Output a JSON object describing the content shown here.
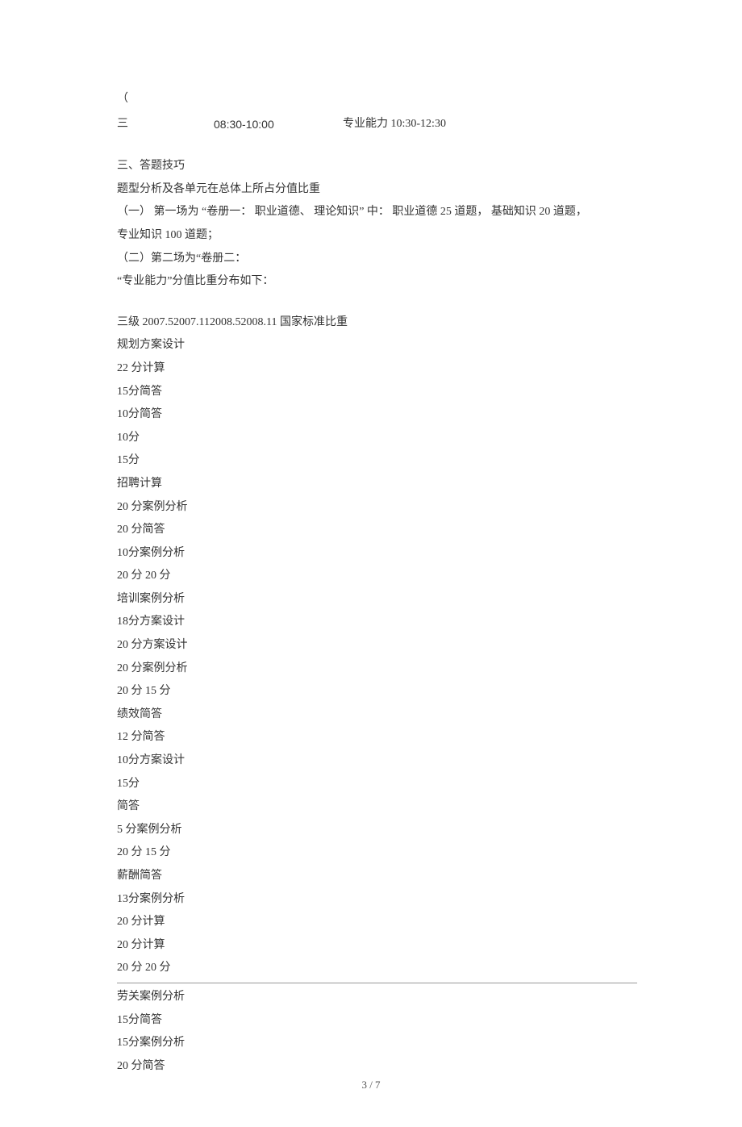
{
  "schedule": {
    "row1_col1": "（",
    "row2_col1": "三",
    "row2_col2": "08:30-10:00",
    "row2_col3": "专业能力 10:30-12:30"
  },
  "section3": {
    "heading": "三、答题技巧",
    "line1": "题型分析及各单元在总体上所占分值比重",
    "line2": "（一） 第一场为 “卷册一： 职业道德、 理论知识” 中： 职业道德 25 道题， 基础知识 20 道题，",
    "line3": "专业知识 100 道题；",
    "line4": "（二）第二场为“卷册二：",
    "line5": "“专业能力”分值比重分布如下："
  },
  "list": {
    "header": "三级 2007.52007.112008.52008.11 国家标准比重",
    "items_a": [
      "规划方案设计",
      "22 分计算",
      "15分简答",
      "10分简答",
      "10分",
      "15分",
      "招聘计算",
      "20 分案例分析",
      "20 分简答",
      "10分案例分析",
      "20 分 20 分",
      "培训案例分析",
      "18分方案设计",
      "20 分方案设计",
      "20 分案例分析",
      "20 分 15 分",
      "绩效简答",
      "12 分简答",
      "10分方案设计",
      "15分",
      "简答",
      "5 分案例分析",
      "20 分 15 分",
      "薪酬简答",
      "13分案例分析",
      "20 分计算",
      "20 分计算",
      "20 分 20 分"
    ],
    "items_b": [
      "劳关案例分析",
      "15分简答",
      "15分案例分析",
      "20 分简答"
    ]
  },
  "footer": "3 / 7"
}
